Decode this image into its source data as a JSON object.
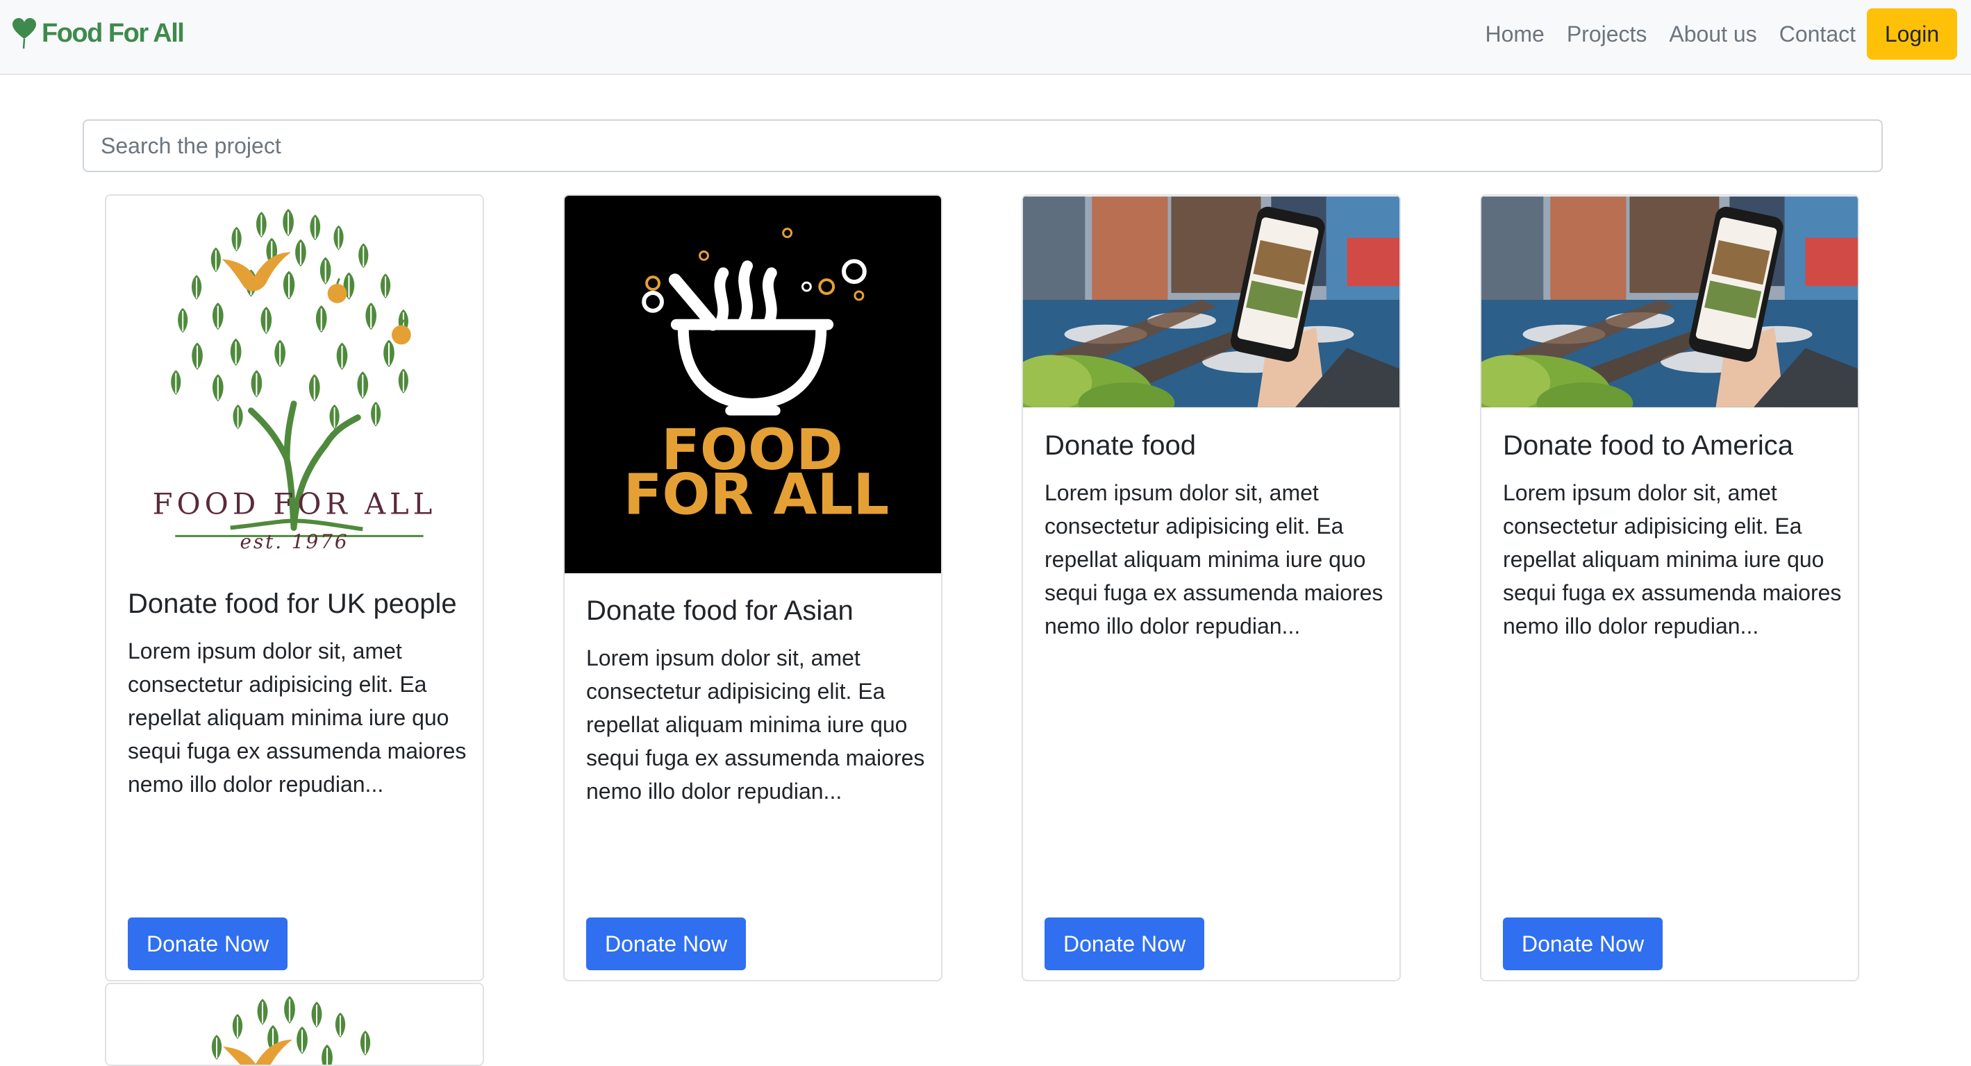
{
  "brand": {
    "name": "Food For All",
    "icon": "heart-balloon-icon",
    "color": "#3e8a4c"
  },
  "nav": {
    "links": [
      "Home",
      "Projects",
      "About us",
      "Contact"
    ],
    "login_label": "Login"
  },
  "search": {
    "placeholder": "Search the project",
    "value": ""
  },
  "logo_texts": {
    "tree_logo": {
      "line1": "FOOD FOR ALL",
      "line2": "est. 1976"
    },
    "bowl_logo": {
      "line1": "FOOD",
      "line2": "FOR ALL"
    }
  },
  "cards": [
    {
      "image": "food-for-all-tree-logo",
      "title": "Donate food for UK people",
      "text": "Lorem ipsum dolor sit, amet consectetur adipisicing elit. Ea repellat aliquam minima iure quo sequi fuga ex assumenda maiores nemo illo dolor repudian...",
      "button": "Donate Now"
    },
    {
      "image": "food-for-all-bowl-logo",
      "title": "Donate food for Asian",
      "text": "Lorem ipsum dolor sit, amet consectetur adipisicing elit. Ea repellat aliquam minima iure quo sequi fuga ex assumenda maiores nemo illo dolor repudian...",
      "button": "Donate Now"
    },
    {
      "image": "phone-in-cafe-photo",
      "title": "Donate food",
      "text": "Lorem ipsum dolor sit, amet consectetur adipisicing elit. Ea repellat aliquam minima iure quo sequi fuga ex assumenda maiores nemo illo dolor repudian...",
      "button": "Donate Now"
    },
    {
      "image": "phone-in-cafe-photo",
      "title": "Donate food to America",
      "text": "Lorem ipsum dolor sit, amet consectetur adipisicing elit. Ea repellat aliquam minima iure quo sequi fuga ex assumenda maiores nemo illo dolor repudian...",
      "button": "Donate Now"
    }
  ],
  "colors": {
    "primary_button": "#2f6ff0",
    "login_button": "#ffc107",
    "navbar_bg": "#f8f9fa",
    "tree_green": "#4f8a3c",
    "logo_orange": "#e5a035"
  }
}
